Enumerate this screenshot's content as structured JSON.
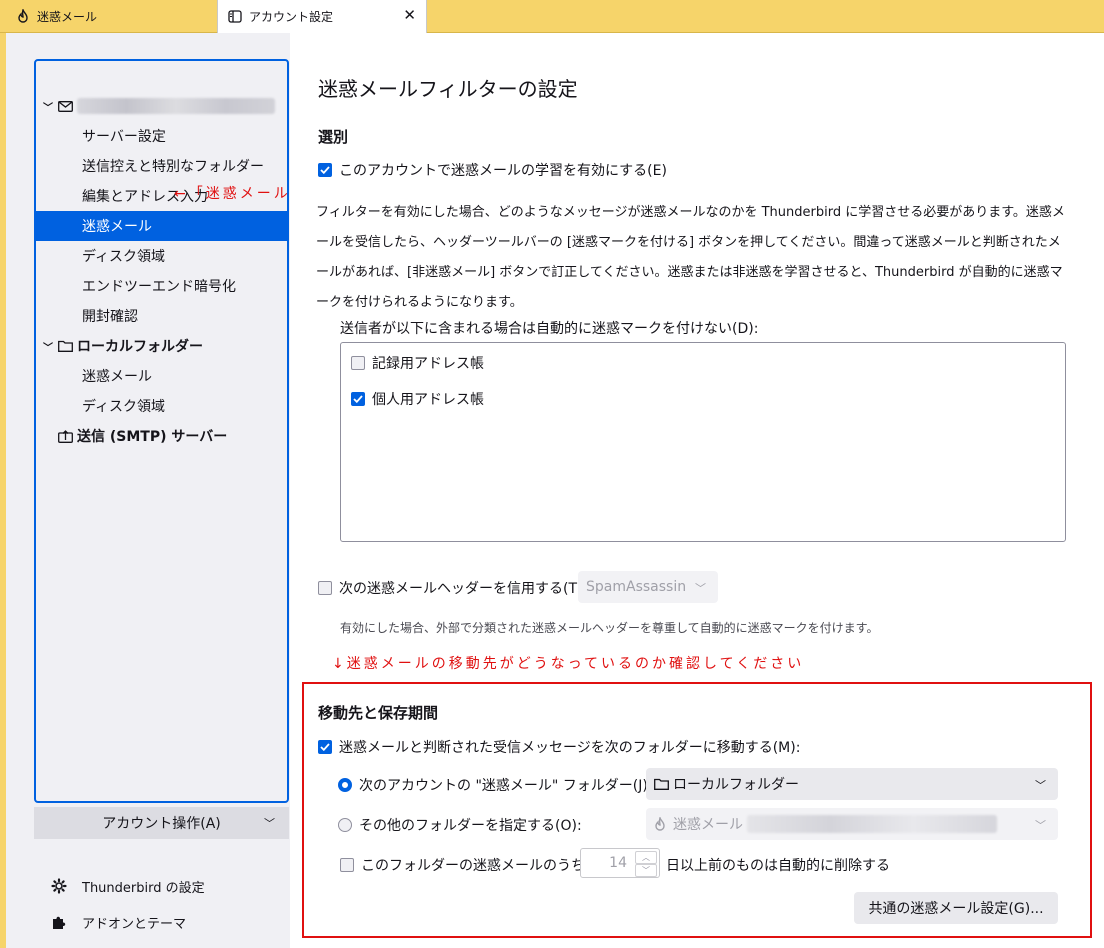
{
  "tabs": [
    {
      "label": "迷惑メール",
      "icon": "flame-icon",
      "active": false
    },
    {
      "label": "アカウント設定",
      "icon": "settings-page-icon",
      "active": true
    }
  ],
  "sidebar": {
    "account_name_blurred": "",
    "items": [
      {
        "label": "サーバー設定"
      },
      {
        "label": "送信控えと特別なフォルダー"
      },
      {
        "label": "編集とアドレス入力"
      },
      {
        "label": "迷惑メール",
        "selected": true
      },
      {
        "label": "ディスク領域"
      },
      {
        "label": "エンドツーエンド暗号化"
      },
      {
        "label": "開封確認"
      }
    ],
    "local_folders": {
      "label": "ローカルフォルダー",
      "items": [
        {
          "label": "迷惑メール"
        },
        {
          "label": "ディスク領域"
        }
      ]
    },
    "smtp": {
      "label": "送信 (SMTP) サーバー"
    },
    "account_actions": "アカウント操作(A)",
    "settings_link": "Thunderbird の設定",
    "addons_link": "アドオンとテーマ",
    "annotation": "←「迷惑メール」をクリック"
  },
  "main": {
    "title": "迷惑メールフィルターの設定",
    "section1": {
      "heading": "選別",
      "enable_learning": {
        "label": "このアカウントで迷惑メールの学習を有効にする(E)",
        "checked": true
      },
      "description": "フィルターを有効にした場合、どのようなメッセージが迷惑メールなのかを Thunderbird に学習させる必要があります。迷惑メールを受信したら、ヘッダーツールバーの [迷惑マークを付ける] ボタンを押してください。間違って迷惑メールと判断されたメールがあれば、[非迷惑メール] ボタンで訂正してください。迷惑または非迷惑を学習させると、Thunderbird が自動的に迷惑マークを付けられるようになります。",
      "whitelist_label": "送信者が以下に含まれる場合は自動的に迷惑マークを付けない(D):",
      "addressbooks": [
        {
          "label": "記録用アドレス帳",
          "checked": false
        },
        {
          "label": "個人用アドレス帳",
          "checked": true
        }
      ],
      "trust_header": {
        "label": "次の迷惑メールヘッダーを信用する(T):",
        "checked": false
      },
      "trust_header_select": "SpamAssassin",
      "trust_header_note": "有効にした場合、外部で分類された迷惑メールヘッダーを尊重して自動的に迷惑マークを付けます。"
    },
    "annotation": "↓迷惑メールの移動先がどうなっているのか確認してください",
    "section2": {
      "heading": "移動先と保存期間",
      "move_option": {
        "label": "迷惑メールと判断された受信メッセージを次のフォルダーに移動する(M):",
        "checked": true
      },
      "radio_account": {
        "label": "次のアカウントの \"迷惑メール\" フォルダー(J):",
        "selected": true
      },
      "account_select": "ローカルフォルダー",
      "radio_other": {
        "label": "その他のフォルダーを指定する(O):",
        "selected": false
      },
      "other_select": "迷惑メール",
      "purge_option": {
        "label": "このフォルダーの迷惑メールのうち(U)",
        "checked": false
      },
      "purge_days": "14",
      "purge_suffix": "日以上前のものは自動的に削除する",
      "global_button": "共通の迷惑メール設定(G)..."
    }
  }
}
